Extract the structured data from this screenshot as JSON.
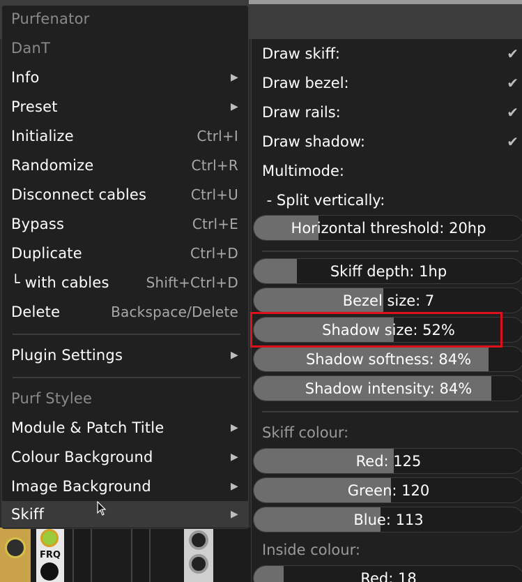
{
  "menu": {
    "module_name": "Purfenator",
    "brand": "DanT",
    "items": {
      "info": "Info",
      "preset": "Preset",
      "initialize": {
        "label": "Initialize",
        "shortcut": "Ctrl+I"
      },
      "randomize": {
        "label": "Randomize",
        "shortcut": "Ctrl+R"
      },
      "disconnect": {
        "label": "Disconnect cables",
        "shortcut": "Ctrl+U"
      },
      "bypass": {
        "label": "Bypass",
        "shortcut": "Ctrl+E"
      },
      "duplicate": {
        "label": "Duplicate",
        "shortcut": "Ctrl+D"
      },
      "duplicate_with_cables": {
        "label": "└ with cables",
        "shortcut": "Shift+Ctrl+D"
      },
      "delete": {
        "label": "Delete",
        "shortcut": "Backspace/Delete"
      },
      "plugin_settings": "Plugin Settings",
      "section_header": "Purf Stylee",
      "module_patch_title": "Module & Patch Title",
      "colour_background": "Colour Background",
      "image_background": "Image Background",
      "skiff": "Skiff"
    },
    "submenu_arrow": "▶"
  },
  "submenu": {
    "draw_skiff": "Draw skiff:",
    "draw_bezel": "Draw bezel:",
    "draw_rails": "Draw rails:",
    "draw_shadow": "Draw shadow:",
    "check": "✔",
    "multimode": "Multimode:",
    "split_vertically": " - Split vertically:",
    "horizontal_threshold": {
      "label": "Horizontal threshold: 20hp",
      "value": 0.24
    },
    "skiff_depth": {
      "label": "Skiff depth: 1hp",
      "value": 0.16
    },
    "bezel_size": {
      "label": "Bezel size: 7",
      "value": 0.48
    },
    "shadow_size": {
      "label": "Shadow size: 52%",
      "value": 0.52
    },
    "shadow_softness": {
      "label": "Shadow softness: 84%",
      "value": 0.87
    },
    "shadow_intensity": {
      "label": "Shadow intensity: 84%",
      "value": 0.88
    },
    "skiff_colour_header": "Skiff colour:",
    "red": {
      "label": "Red: 125",
      "value": 0.52
    },
    "green": {
      "label": "Green: 120",
      "value": 0.51
    },
    "blue": {
      "label": "Blue: 113",
      "value": 0.47
    },
    "inside_colour_header": "Inside colour:",
    "inside_red": {
      "label": "Red: 18",
      "value": 0.11
    }
  },
  "rack": {
    "module_label": "FRQ"
  },
  "colors": {
    "highlight": "#e0101a",
    "slider_fill": "#6d6d6d",
    "menu_bg": "#202020"
  }
}
